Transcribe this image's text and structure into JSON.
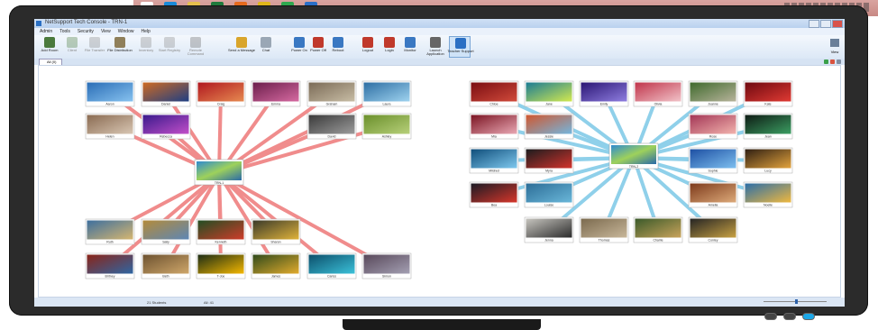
{
  "taskbar": {
    "icons": [
      {
        "name": "windows-start-icon",
        "color": "#ffffff"
      },
      {
        "name": "internet-explorer-icon",
        "color": "#1a8ad8"
      },
      {
        "name": "file-explorer-icon",
        "color": "#e6c04d"
      },
      {
        "name": "excel-icon",
        "color": "#1f7a3c"
      },
      {
        "name": "firefox-icon",
        "color": "#e66a1d"
      },
      {
        "name": "chrome-icon",
        "color": "#e0b61a"
      },
      {
        "name": "vine-icon",
        "color": "#2fa84f"
      },
      {
        "name": "netsupport-icon",
        "color": "#2b6fc7"
      }
    ]
  },
  "window": {
    "title": "NetSupport Tech Console - TRN-1",
    "menus": [
      "Admin",
      "Tools",
      "Security",
      "View",
      "Window",
      "Help"
    ]
  },
  "ribbon": {
    "buttons": [
      {
        "id": "add",
        "label": "Add Room",
        "icon": "add-users-icon",
        "color": "#4b7a3d",
        "disabled": false
      },
      {
        "id": "client",
        "label": "Client",
        "icon": "client-icon",
        "color": "#4b7a3d",
        "disabled": true
      },
      {
        "id": "files",
        "label": "File Transfer",
        "icon": "file-transfer-icon",
        "color": "#8a8a8a",
        "disabled": true
      },
      {
        "id": "dist",
        "label": "File Distribution",
        "icon": "file-distribution-icon",
        "color": "#8f7f5a",
        "disabled": false
      },
      {
        "id": "inv",
        "label": "Inventory",
        "icon": "inventory-icon",
        "color": "#8a8a8a",
        "disabled": true
      },
      {
        "id": "reg",
        "label": "Start Registry",
        "icon": "registry-icon",
        "color": "#8a8a8a",
        "disabled": true
      },
      {
        "id": "rem",
        "label": "Remote Command",
        "icon": "remote-command-icon",
        "color": "#666666",
        "disabled": true
      },
      {
        "id": "msg",
        "label": "Send a Message",
        "icon": "message-icon",
        "color": "#d9a52b",
        "disabled": false
      },
      {
        "id": "chat",
        "label": "Chat",
        "icon": "chat-icon",
        "color": "#9aa7b5",
        "disabled": false
      },
      {
        "id": "pon",
        "label": "Power On",
        "icon": "power-on-icon",
        "color": "#3a78c2",
        "disabled": false
      },
      {
        "id": "poff",
        "label": "Power Off",
        "icon": "power-off-icon",
        "color": "#c0392b",
        "disabled": false
      },
      {
        "id": "reboot",
        "label": "Reboot",
        "icon": "reboot-icon",
        "color": "#3a78c2",
        "disabled": false
      },
      {
        "id": "logout",
        "label": "Logout",
        "icon": "logout-icon",
        "color": "#c0392b",
        "disabled": false
      },
      {
        "id": "login",
        "label": "Login",
        "icon": "login-icon",
        "color": "#c0392b",
        "disabled": false
      },
      {
        "id": "mnt",
        "label": "Monitor",
        "icon": "monitor-icon",
        "color": "#3a78c2",
        "disabled": false
      },
      {
        "id": "launch",
        "label": "Launch Application",
        "icon": "launch-icon",
        "color": "#666666",
        "disabled": false
      },
      {
        "id": "teacher",
        "label": "Teacher Support",
        "icon": "teacher-support-icon",
        "color": "#2a6fc3",
        "disabled": false,
        "selected": true
      }
    ],
    "view_label": "View"
  },
  "tabs": [
    {
      "label": "All (0)"
    }
  ],
  "groups": [
    {
      "name": "left-room",
      "center_label": "TRN-1",
      "line_color": "#f08c8c",
      "clients": [
        {
          "label": "Aaron",
          "img": [
            "#2a6db6",
            "#87c2ef"
          ]
        },
        {
          "label": "Daniel",
          "img": [
            "#ce6a22",
            "#1f3f84"
          ]
        },
        {
          "label": "Craig",
          "img": [
            "#b0171f",
            "#e68a50"
          ]
        },
        {
          "label": "Emma",
          "img": [
            "#6b1e4b",
            "#d66aa1"
          ]
        },
        {
          "label": "Graham",
          "img": [
            "#7b6b57",
            "#c8bda5"
          ]
        },
        {
          "label": "Laura",
          "img": [
            "#2d6ea3",
            "#9fd3ef"
          ]
        },
        {
          "label": "Helen",
          "img": [
            "#8a6b52",
            "#d8c6b3"
          ]
        },
        {
          "label": "Rebecca",
          "img": [
            "#3a1a8c",
            "#c24fc9"
          ]
        },
        {
          "label": "David",
          "img": [
            "#3a3a3a",
            "#9c9c9c"
          ]
        },
        {
          "label": "Ashley",
          "img": [
            "#6a8f2b",
            "#b7d07a"
          ]
        },
        {
          "label": "Ruth",
          "img": [
            "#3d6f9e",
            "#d6b670"
          ]
        },
        {
          "label": "Sally",
          "img": [
            "#b48b3a",
            "#5d86b5"
          ]
        },
        {
          "label": "Kenneth",
          "img": [
            "#224d22",
            "#cf3c2a"
          ]
        },
        {
          "label": "Sharon",
          "img": [
            "#3a3a2a",
            "#e0b33a"
          ]
        },
        {
          "label": "Britney",
          "img": [
            "#8a2418",
            "#2f66a3"
          ]
        },
        {
          "label": "Beth",
          "img": [
            "#6d5230",
            "#cfa76a"
          ]
        },
        {
          "label": "T-Joe",
          "img": [
            "#1c2d15",
            "#f4b700"
          ]
        },
        {
          "label": "James",
          "img": [
            "#2f4a1b",
            "#e2ab2d"
          ]
        },
        {
          "label": "Carlos",
          "img": [
            "#0c4f6b",
            "#3bc1d9"
          ]
        },
        {
          "label": "Simon",
          "img": [
            "#58485a",
            "#a4a0b3"
          ]
        }
      ]
    },
    {
      "name": "right-room",
      "center_label": "TRN-2",
      "line_color": "#8fd0ea",
      "clients": [
        {
          "label": "Chloe",
          "img": [
            "#7a0d12",
            "#d14a3a"
          ]
        },
        {
          "label": "Jane",
          "img": [
            "#1b7c94",
            "#d3e94f"
          ]
        },
        {
          "label": "Emily",
          "img": [
            "#2a1573",
            "#8f7ee0"
          ]
        },
        {
          "label": "Olivia",
          "img": [
            "#c0344a",
            "#f1c3c9"
          ]
        },
        {
          "label": "Joanne",
          "img": [
            "#3f6a2d",
            "#b7b39b"
          ]
        },
        {
          "label": "Kate",
          "img": [
            "#6e0910",
            "#e03a33"
          ]
        },
        {
          "label": "Mia",
          "img": [
            "#7b1422",
            "#e9a8b4"
          ]
        },
        {
          "label": "Jessie",
          "img": [
            "#d0572e",
            "#74b6de"
          ]
        },
        {
          "label": "Rose",
          "img": [
            "#a33656",
            "#f2b3ad"
          ]
        },
        {
          "label": "Jean",
          "img": [
            "#0e1b14",
            "#3b9e62"
          ]
        },
        {
          "label": "Mildred",
          "img": [
            "#0f4d7a",
            "#7ec8ee"
          ]
        },
        {
          "label": "Myra",
          "img": [
            "#1b1c1e",
            "#d3332c"
          ]
        },
        {
          "label": "Sophie",
          "img": [
            "#1d4fa3",
            "#7dbfef"
          ]
        },
        {
          "label": "Lucy",
          "img": [
            "#2f1f12",
            "#e3a33d"
          ]
        },
        {
          "label": "Bea",
          "img": [
            "#1a1a24",
            "#d7362a"
          ]
        },
        {
          "label": "Louise",
          "img": [
            "#2c6d97",
            "#6ab7d9"
          ]
        },
        {
          "label": "Amelia",
          "img": [
            "#7d3a1b",
            "#ddaa7a"
          ]
        },
        {
          "label": "Noelle",
          "img": [
            "#2b6ea8",
            "#f0b83e"
          ]
        },
        {
          "label": "Jenna",
          "img": [
            "#c7c5bf",
            "#2b2b2b"
          ]
        },
        {
          "label": "Thomas",
          "img": [
            "#7b6a4e",
            "#c8b79a"
          ]
        },
        {
          "label": "Charlie",
          "img": [
            "#3a5a2a",
            "#c9a35a"
          ]
        },
        {
          "label": "Conley",
          "img": [
            "#242424",
            "#c8a142"
          ]
        }
      ]
    }
  ],
  "status": {
    "students": "21 Students",
    "count": "All: 41"
  }
}
